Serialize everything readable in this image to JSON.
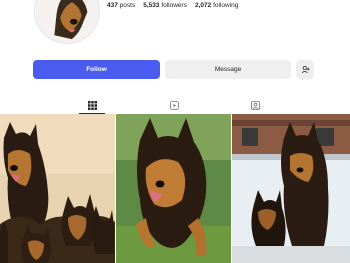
{
  "profile": {
    "stats": [
      {
        "value": "437",
        "label": "posts"
      },
      {
        "value": "5,533",
        "label": "followers"
      },
      {
        "value": "2,072",
        "label": "following"
      }
    ]
  },
  "actions": {
    "follow_label": "Follow",
    "message_label": "Message",
    "suggest_icon": "add-person-icon"
  },
  "tabs": [
    {
      "name": "posts",
      "icon": "grid-icon",
      "active": true
    },
    {
      "name": "reels",
      "icon": "reels-icon",
      "active": false
    },
    {
      "name": "tagged",
      "icon": "tagged-icon",
      "active": false
    }
  ],
  "colors": {
    "follow_button": "#4a5cf0",
    "secondary_button": "#efefef",
    "text": "#262626"
  }
}
